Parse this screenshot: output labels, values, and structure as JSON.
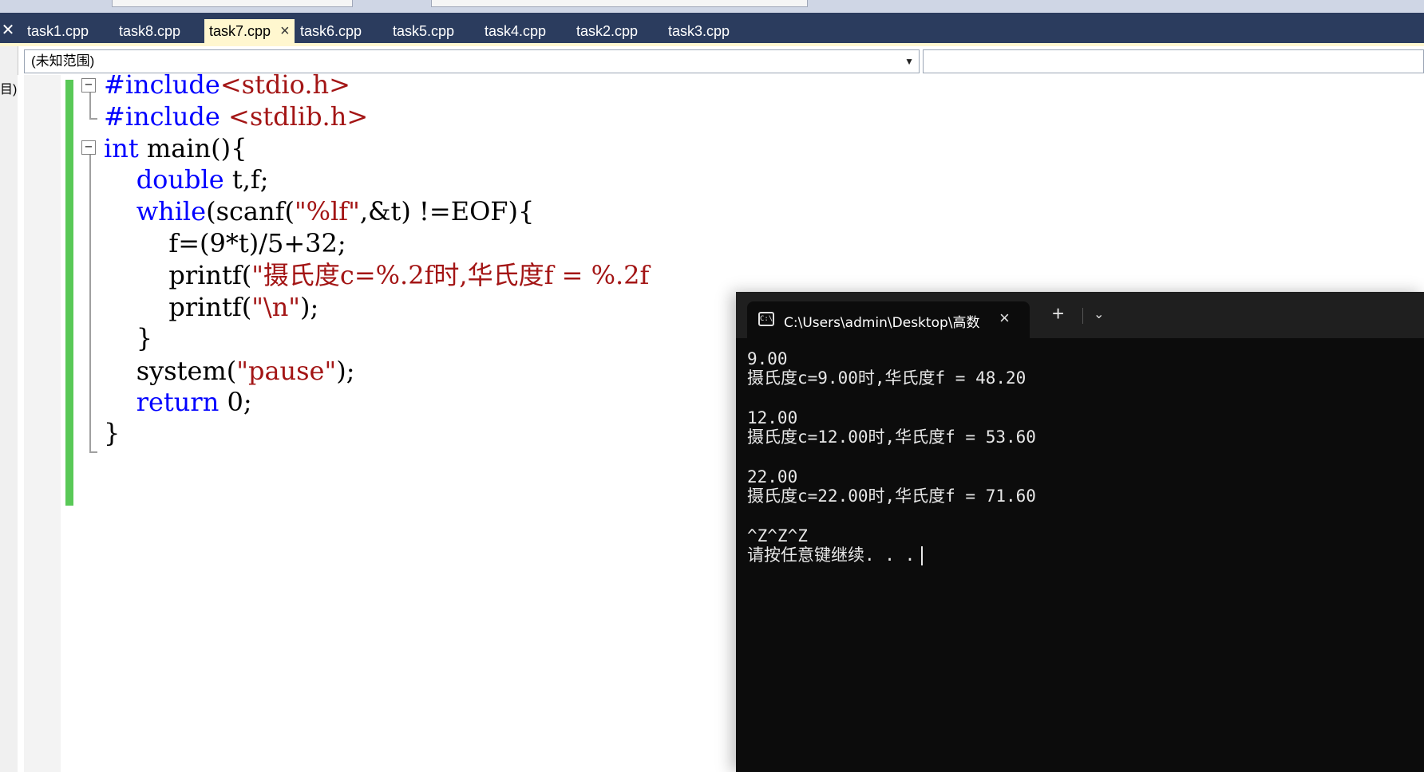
{
  "ide": {
    "tabs": [
      {
        "label": "task1.cpp",
        "active": false
      },
      {
        "label": "task8.cpp",
        "active": false
      },
      {
        "label": "task7.cpp",
        "active": true
      },
      {
        "label": "task6.cpp",
        "active": false
      },
      {
        "label": "task5.cpp",
        "active": false
      },
      {
        "label": "task4.cpp",
        "active": false
      },
      {
        "label": "task2.cpp",
        "active": false
      },
      {
        "label": "task3.cpp",
        "active": false
      }
    ],
    "active_tab_close": "×",
    "left_fragment": "目)",
    "scope_label": "(未知范围)",
    "code_lines": [
      [
        {
          "t": "#include",
          "c": "kw"
        },
        {
          "t": "<stdio.h>",
          "c": "str"
        }
      ],
      [
        {
          "t": "#include",
          "c": "kw"
        },
        {
          "t": " ",
          "c": "txt"
        },
        {
          "t": "<stdlib.h>",
          "c": "str"
        }
      ],
      [
        {
          "t": "int",
          "c": "kw"
        },
        {
          "t": " main(){",
          "c": "txt"
        }
      ],
      [
        {
          "t": "    ",
          "c": "txt"
        },
        {
          "t": "double",
          "c": "kw"
        },
        {
          "t": " t,f;",
          "c": "txt"
        }
      ],
      [
        {
          "t": "    ",
          "c": "txt"
        },
        {
          "t": "while",
          "c": "kw"
        },
        {
          "t": "(scanf(",
          "c": "txt"
        },
        {
          "t": "\"%lf\"",
          "c": "str"
        },
        {
          "t": ",&t) !=EOF){",
          "c": "txt"
        }
      ],
      [
        {
          "t": "        f=(9*t)/5+32;",
          "c": "txt"
        }
      ],
      [
        {
          "t": "        printf(",
          "c": "txt"
        },
        {
          "t": "\"摄氏度c=%.2f时,华氏度f = %.2f",
          "c": "str"
        }
      ],
      [
        {
          "t": "        printf(",
          "c": "txt"
        },
        {
          "t": "\"\\n\"",
          "c": "str"
        },
        {
          "t": ");",
          "c": "txt"
        }
      ],
      [
        {
          "t": "    }",
          "c": "txt"
        }
      ],
      [
        {
          "t": "    system(",
          "c": "txt"
        },
        {
          "t": "\"pause\"",
          "c": "str"
        },
        {
          "t": ");",
          "c": "txt"
        }
      ],
      [
        {
          "t": "    ",
          "c": "txt"
        },
        {
          "t": "return",
          "c": "kw"
        },
        {
          "t": " 0;",
          "c": "txt"
        }
      ],
      [
        {
          "t": "}",
          "c": "txt"
        }
      ]
    ]
  },
  "terminal": {
    "tab_title": "C:\\Users\\admin\\Desktop\\高数",
    "tab_close": "×",
    "new_tab": "+",
    "dropdown": "⌄",
    "lines": [
      "9.00",
      "摄氏度c=9.00时,华氏度f = 48.20",
      "",
      "12.00",
      "摄氏度c=12.00时,华氏度f = 53.60",
      "",
      "22.00",
      "摄氏度c=22.00时,华氏度f = 71.60",
      "",
      "^Z^Z^Z",
      "请按任意键继续. . ."
    ]
  }
}
